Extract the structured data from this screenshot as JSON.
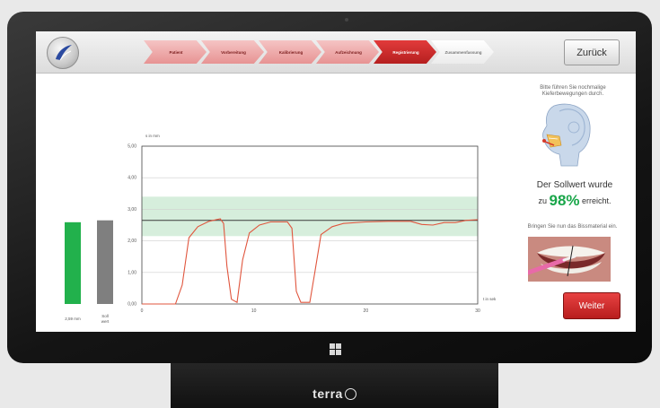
{
  "device": {
    "brand": "terra"
  },
  "header": {
    "steps": [
      {
        "label": "Patient",
        "state": "done"
      },
      {
        "label": "Vorbereitung",
        "state": "done"
      },
      {
        "label": "Kalibrierung",
        "state": "done"
      },
      {
        "label": "Aufzeichnung",
        "state": "done"
      },
      {
        "label": "Registrierung",
        "state": "active"
      },
      {
        "label": "Zusammenfassung",
        "state": "todo"
      }
    ],
    "back_label": "Zurück"
  },
  "colors": {
    "accent_red": "#c62828",
    "bar_green": "#22b14c",
    "bar_gray": "#7f7f7f",
    "band_green": "#c8e8d0",
    "curve": "#e0553d"
  },
  "bars": {
    "current_label": "2,59 mm",
    "target_label": "Soll wert"
  },
  "chart_data": {
    "type": "line",
    "ylabel": "s in mm",
    "xlabel": "t in sek",
    "xlim": [
      0,
      30
    ],
    "ylim": [
      0,
      5
    ],
    "x_ticks": [
      "0",
      "10",
      "20",
      "30"
    ],
    "y_ticks": [
      "0,00",
      "1,00",
      "2,00",
      "3,00",
      "4,00",
      "5,00"
    ],
    "target_value": 2.65,
    "tolerance_band": [
      2.15,
      3.4
    ],
    "series": [
      {
        "values": [
          [
            0,
            0
          ],
          [
            3,
            0
          ],
          [
            3.6,
            0.6
          ],
          [
            4.2,
            2.1
          ],
          [
            5,
            2.45
          ],
          [
            6,
            2.62
          ],
          [
            7,
            2.7
          ],
          [
            7.3,
            2.55
          ],
          [
            7.6,
            1.2
          ],
          [
            8,
            0.15
          ],
          [
            8.5,
            0.05
          ],
          [
            9,
            1.4
          ],
          [
            9.6,
            2.25
          ],
          [
            10.5,
            2.5
          ],
          [
            11.5,
            2.6
          ],
          [
            13,
            2.6
          ],
          [
            13.4,
            2.4
          ],
          [
            13.8,
            0.4
          ],
          [
            14.2,
            0.05
          ],
          [
            15,
            0.05
          ],
          [
            15.4,
            0.9
          ],
          [
            16,
            2.2
          ],
          [
            17,
            2.45
          ],
          [
            18,
            2.55
          ],
          [
            20,
            2.6
          ],
          [
            22,
            2.62
          ],
          [
            24,
            2.62
          ],
          [
            25,
            2.52
          ],
          [
            26,
            2.5
          ],
          [
            27,
            2.58
          ],
          [
            28,
            2.58
          ],
          [
            29,
            2.65
          ],
          [
            30,
            2.67
          ]
        ]
      }
    ]
  },
  "sidebar": {
    "instruction": "Bitte führen Sie nochmalige Kieferbewegungen durch.",
    "result_line1": "Der Sollwert wurde",
    "result_prefix": "zu",
    "result_pct": "98%",
    "result_suffix": "erreicht.",
    "instruction2": "Bringen Sie nun das Bissmaterial ein.",
    "next_label": "Weiter"
  }
}
